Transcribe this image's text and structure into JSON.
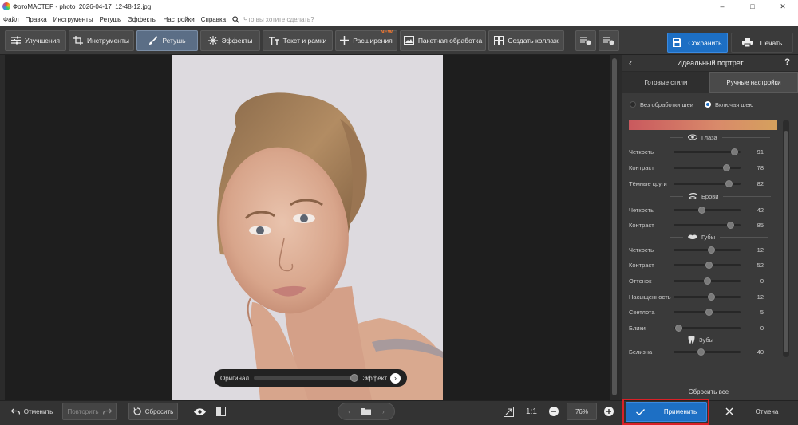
{
  "window": {
    "title": "ФотоМАСТЕР - photo_2026-04-17_12-48-12.jpg",
    "controls": [
      "–",
      "□",
      "✕"
    ]
  },
  "menu": {
    "items": [
      "Файл",
      "Правка",
      "Инструменты",
      "Ретушь",
      "Эффекты",
      "Настройки",
      "Справка"
    ],
    "search_placeholder": "Что вы хотите сделать?"
  },
  "toolbar": {
    "tabs": [
      {
        "label": "Улучшения",
        "icon": "sliders-icon"
      },
      {
        "label": "Инструменты",
        "icon": "crop-icon"
      },
      {
        "label": "Ретушь",
        "icon": "brush-icon",
        "active": true
      },
      {
        "label": "Эффекты",
        "icon": "sparkle-icon"
      },
      {
        "label": "Текст и рамки",
        "icon": "text-icon"
      },
      {
        "label": "Расширения",
        "icon": "plus-icon",
        "badge": "NEW"
      },
      {
        "label": "Пакетная обработка",
        "icon": "image-batch-icon"
      },
      {
        "label": "Создать коллаж",
        "icon": "collage-icon"
      }
    ],
    "save_label": "Сохранить",
    "print_label": "Печать"
  },
  "compare": {
    "original_label": "Оригинал",
    "effect_label": "Эффект"
  },
  "panel": {
    "title": "Идеальный портрет",
    "tabs": [
      "Готовые стили",
      "Ручные настройки"
    ],
    "active_tab": 1,
    "radios": [
      "Без обработки шеи",
      "Включая шею"
    ],
    "radio_selected": 1,
    "sections": {
      "eyes": {
        "title": "Глаза",
        "sliders": [
          {
            "label": "Четкость",
            "value": "91"
          },
          {
            "label": "Контраст",
            "value": "78"
          },
          {
            "label": "Тёмные круги",
            "value": "82"
          }
        ]
      },
      "brows": {
        "title": "Брови",
        "sliders": [
          {
            "label": "Четкость",
            "value": "42"
          },
          {
            "label": "Контраст",
            "value": "85"
          }
        ]
      },
      "lips": {
        "title": "Губы",
        "sliders": [
          {
            "label": "Четкость",
            "value": "12"
          },
          {
            "label": "Контраст",
            "value": "52"
          },
          {
            "label": "Оттенок",
            "value": "0"
          },
          {
            "label": "Насыщенность",
            "value": "12"
          },
          {
            "label": "Светлота",
            "value": "5"
          },
          {
            "label": "Блики",
            "value": "0"
          }
        ]
      },
      "teeth": {
        "title": "Зубы",
        "sliders": [
          {
            "label": "Белизна",
            "value": "40"
          }
        ]
      }
    },
    "reset_all": "Сбросить все"
  },
  "bottom": {
    "undo": "Отменить",
    "redo": "Повторить",
    "reset": "Сбросить",
    "ratio": "1:1",
    "zoom": "76%",
    "apply": "Применить",
    "cancel": "Отмена"
  },
  "colors": {
    "accent": "#1d6fc4",
    "highlight_border": "#d92027",
    "new_badge": "#ff7b2e"
  }
}
